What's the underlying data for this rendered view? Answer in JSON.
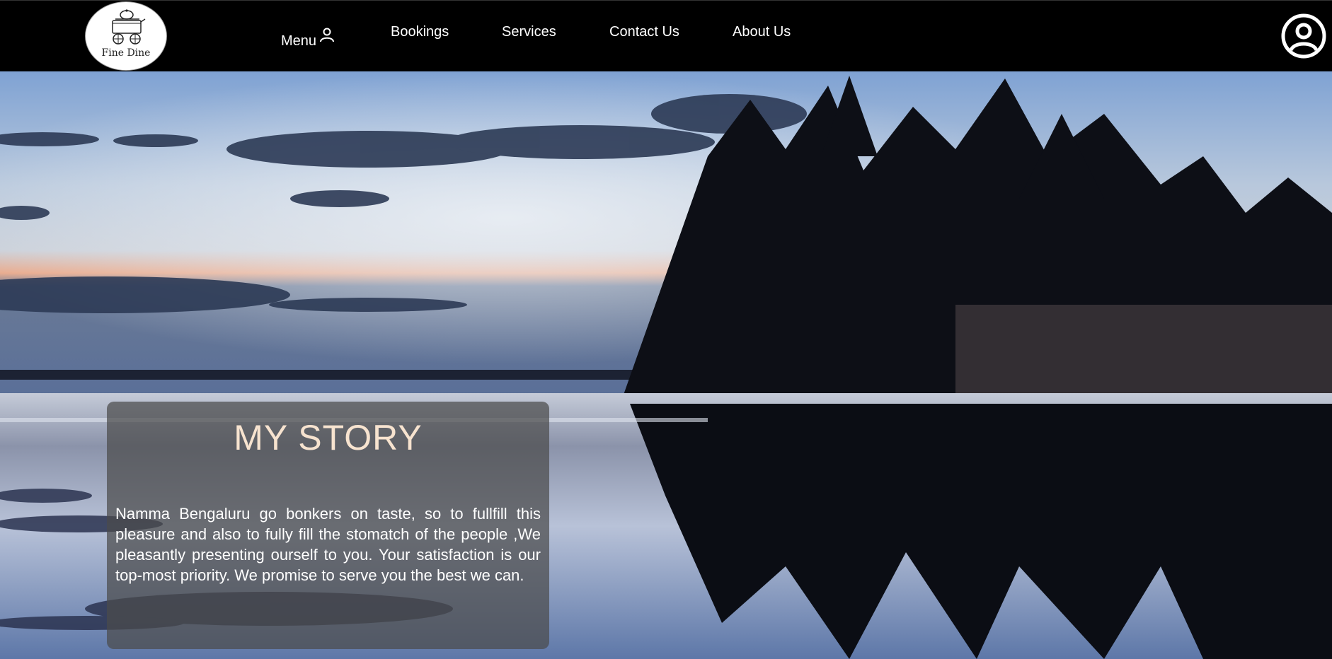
{
  "logo": {
    "text": "Fine Dine",
    "icon": "food-cart-icon"
  },
  "nav": {
    "menu_label": "Menu",
    "menu_icon": "person-icon",
    "bookings_label": "Bookings",
    "services_label": "Services",
    "contact_label": "Contact Us",
    "about_label": "About Us"
  },
  "account": {
    "icon": "user-circle-icon"
  },
  "story": {
    "title": "MY STORY",
    "body": "Namma Bengaluru go bonkers on taste, so to fullfill this pleasure and also to fully fill the stomatch of the people ,We pleasantly presenting ourself to you. Your satisfaction is our top-most priority. We promise to serve you the best we can."
  },
  "colors": {
    "navbar": "#000000",
    "title": "#f7e3cf",
    "card": "rgba(75,75,75,0.72)"
  }
}
